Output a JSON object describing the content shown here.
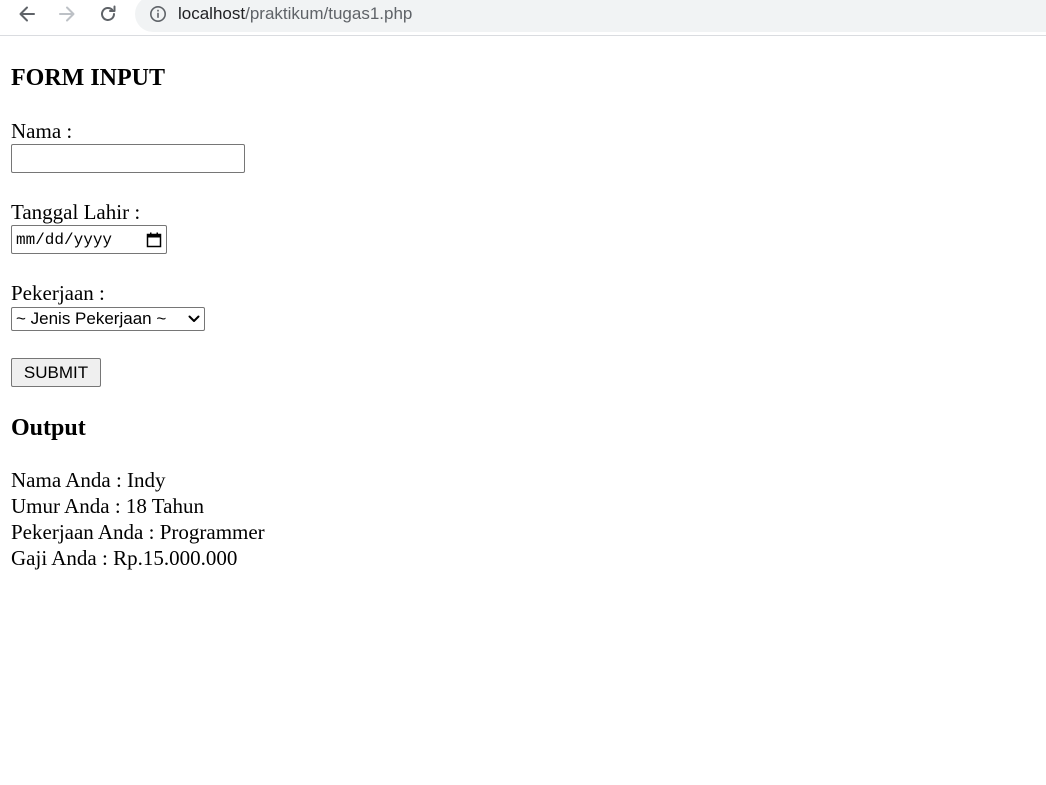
{
  "browser": {
    "url_host": "localhost",
    "url_path": "/praktikum/tugas1.php"
  },
  "form": {
    "title": "FORM INPUT",
    "nama_label": "Nama :",
    "nama_value": "",
    "tanggal_label": "Tanggal Lahir :",
    "tanggal_placeholder": "mm/dd/yyyy",
    "pekerjaan_label": "Pekerjaan :",
    "pekerjaan_selected": "~ Jenis Pekerjaan ~",
    "submit_label": "SUBMIT"
  },
  "output": {
    "title": "Output",
    "lines": [
      "Nama Anda : Indy",
      "Umur Anda : 18 Tahun",
      "Pekerjaan Anda : Programmer",
      "Gaji Anda : Rp.15.000.000"
    ]
  },
  "icons": {
    "back": "back-arrow-icon",
    "forward": "forward-arrow-icon",
    "reload": "reload-icon",
    "info": "info-icon",
    "calendar": "calendar-icon",
    "chevron": "chevron-down-icon"
  }
}
